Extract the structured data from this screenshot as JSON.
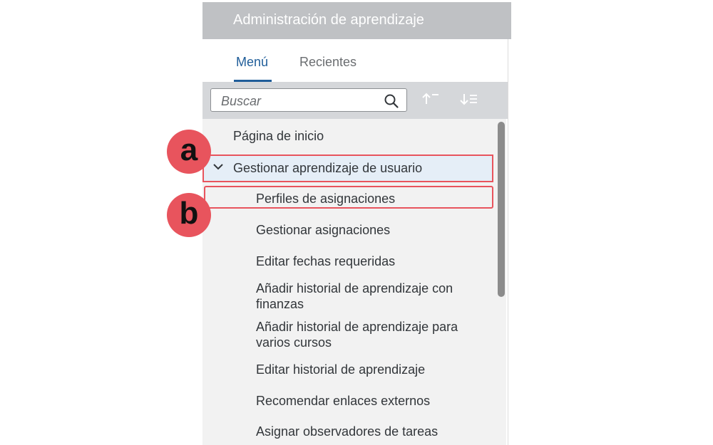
{
  "header": {
    "title": "Administración de aprendizaje"
  },
  "tabs": [
    {
      "label": "Menú",
      "active": true
    },
    {
      "label": "Recientes",
      "active": false
    }
  ],
  "search": {
    "placeholder": "Buscar"
  },
  "toolbar": {
    "sort_ascending_icon": "sort-ascending-icon",
    "sort_descending_icon": "sort-descending-icon"
  },
  "menu": {
    "home": "Página de inicio",
    "section": {
      "label": "Gestionar aprendizaje de usuario",
      "expanded": true,
      "items": [
        {
          "label": "Perfiles de asignaciones"
        },
        {
          "label": "Gestionar asignaciones"
        },
        {
          "label": "Editar fechas requeridas"
        },
        {
          "label": "Añadir historial de aprendizaje con finanzas"
        },
        {
          "label": "Añadir historial de aprendizaje para varios cursos"
        },
        {
          "label": "Editar historial de aprendizaje"
        },
        {
          "label": "Recomendar enlaces externos"
        },
        {
          "label": "Asignar observadores de tareas"
        }
      ]
    }
  },
  "annotations": {
    "a": "a",
    "b": "b"
  },
  "colors": {
    "accent": "#1f5d99",
    "highlight": "#e8545d",
    "header_bg": "#bfc1c4"
  }
}
